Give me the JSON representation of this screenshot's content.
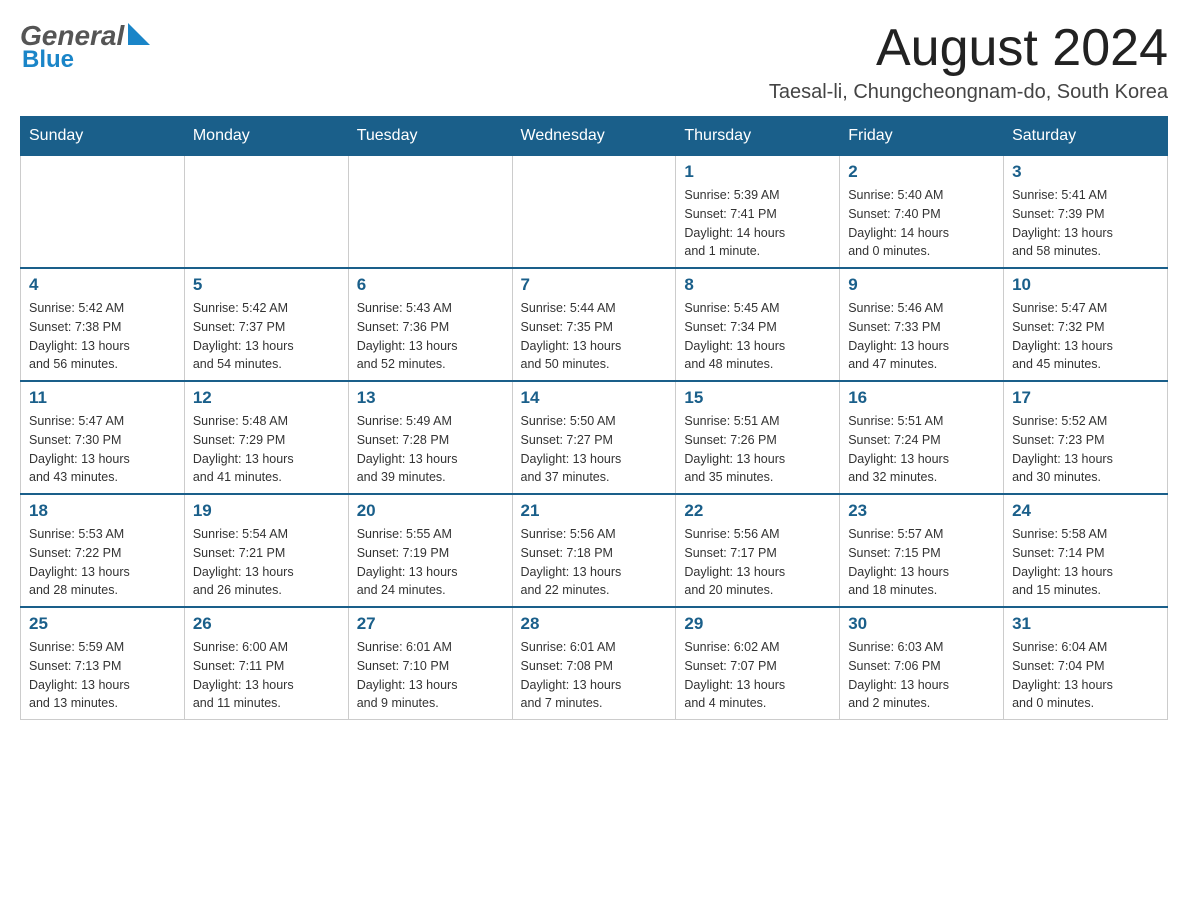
{
  "header": {
    "logo_general": "General",
    "logo_blue": "Blue",
    "month_title": "August 2024",
    "location": "Taesal-li, Chungcheongnam-do, South Korea"
  },
  "days_of_week": [
    "Sunday",
    "Monday",
    "Tuesday",
    "Wednesday",
    "Thursday",
    "Friday",
    "Saturday"
  ],
  "weeks": [
    {
      "days": [
        {
          "number": "",
          "info": ""
        },
        {
          "number": "",
          "info": ""
        },
        {
          "number": "",
          "info": ""
        },
        {
          "number": "",
          "info": ""
        },
        {
          "number": "1",
          "info": "Sunrise: 5:39 AM\nSunset: 7:41 PM\nDaylight: 14 hours\nand 1 minute."
        },
        {
          "number": "2",
          "info": "Sunrise: 5:40 AM\nSunset: 7:40 PM\nDaylight: 14 hours\nand 0 minutes."
        },
        {
          "number": "3",
          "info": "Sunrise: 5:41 AM\nSunset: 7:39 PM\nDaylight: 13 hours\nand 58 minutes."
        }
      ]
    },
    {
      "days": [
        {
          "number": "4",
          "info": "Sunrise: 5:42 AM\nSunset: 7:38 PM\nDaylight: 13 hours\nand 56 minutes."
        },
        {
          "number": "5",
          "info": "Sunrise: 5:42 AM\nSunset: 7:37 PM\nDaylight: 13 hours\nand 54 minutes."
        },
        {
          "number": "6",
          "info": "Sunrise: 5:43 AM\nSunset: 7:36 PM\nDaylight: 13 hours\nand 52 minutes."
        },
        {
          "number": "7",
          "info": "Sunrise: 5:44 AM\nSunset: 7:35 PM\nDaylight: 13 hours\nand 50 minutes."
        },
        {
          "number": "8",
          "info": "Sunrise: 5:45 AM\nSunset: 7:34 PM\nDaylight: 13 hours\nand 48 minutes."
        },
        {
          "number": "9",
          "info": "Sunrise: 5:46 AM\nSunset: 7:33 PM\nDaylight: 13 hours\nand 47 minutes."
        },
        {
          "number": "10",
          "info": "Sunrise: 5:47 AM\nSunset: 7:32 PM\nDaylight: 13 hours\nand 45 minutes."
        }
      ]
    },
    {
      "days": [
        {
          "number": "11",
          "info": "Sunrise: 5:47 AM\nSunset: 7:30 PM\nDaylight: 13 hours\nand 43 minutes."
        },
        {
          "number": "12",
          "info": "Sunrise: 5:48 AM\nSunset: 7:29 PM\nDaylight: 13 hours\nand 41 minutes."
        },
        {
          "number": "13",
          "info": "Sunrise: 5:49 AM\nSunset: 7:28 PM\nDaylight: 13 hours\nand 39 minutes."
        },
        {
          "number": "14",
          "info": "Sunrise: 5:50 AM\nSunset: 7:27 PM\nDaylight: 13 hours\nand 37 minutes."
        },
        {
          "number": "15",
          "info": "Sunrise: 5:51 AM\nSunset: 7:26 PM\nDaylight: 13 hours\nand 35 minutes."
        },
        {
          "number": "16",
          "info": "Sunrise: 5:51 AM\nSunset: 7:24 PM\nDaylight: 13 hours\nand 32 minutes."
        },
        {
          "number": "17",
          "info": "Sunrise: 5:52 AM\nSunset: 7:23 PM\nDaylight: 13 hours\nand 30 minutes."
        }
      ]
    },
    {
      "days": [
        {
          "number": "18",
          "info": "Sunrise: 5:53 AM\nSunset: 7:22 PM\nDaylight: 13 hours\nand 28 minutes."
        },
        {
          "number": "19",
          "info": "Sunrise: 5:54 AM\nSunset: 7:21 PM\nDaylight: 13 hours\nand 26 minutes."
        },
        {
          "number": "20",
          "info": "Sunrise: 5:55 AM\nSunset: 7:19 PM\nDaylight: 13 hours\nand 24 minutes."
        },
        {
          "number": "21",
          "info": "Sunrise: 5:56 AM\nSunset: 7:18 PM\nDaylight: 13 hours\nand 22 minutes."
        },
        {
          "number": "22",
          "info": "Sunrise: 5:56 AM\nSunset: 7:17 PM\nDaylight: 13 hours\nand 20 minutes."
        },
        {
          "number": "23",
          "info": "Sunrise: 5:57 AM\nSunset: 7:15 PM\nDaylight: 13 hours\nand 18 minutes."
        },
        {
          "number": "24",
          "info": "Sunrise: 5:58 AM\nSunset: 7:14 PM\nDaylight: 13 hours\nand 15 minutes."
        }
      ]
    },
    {
      "days": [
        {
          "number": "25",
          "info": "Sunrise: 5:59 AM\nSunset: 7:13 PM\nDaylight: 13 hours\nand 13 minutes."
        },
        {
          "number": "26",
          "info": "Sunrise: 6:00 AM\nSunset: 7:11 PM\nDaylight: 13 hours\nand 11 minutes."
        },
        {
          "number": "27",
          "info": "Sunrise: 6:01 AM\nSunset: 7:10 PM\nDaylight: 13 hours\nand 9 minutes."
        },
        {
          "number": "28",
          "info": "Sunrise: 6:01 AM\nSunset: 7:08 PM\nDaylight: 13 hours\nand 7 minutes."
        },
        {
          "number": "29",
          "info": "Sunrise: 6:02 AM\nSunset: 7:07 PM\nDaylight: 13 hours\nand 4 minutes."
        },
        {
          "number": "30",
          "info": "Sunrise: 6:03 AM\nSunset: 7:06 PM\nDaylight: 13 hours\nand 2 minutes."
        },
        {
          "number": "31",
          "info": "Sunrise: 6:04 AM\nSunset: 7:04 PM\nDaylight: 13 hours\nand 0 minutes."
        }
      ]
    }
  ]
}
